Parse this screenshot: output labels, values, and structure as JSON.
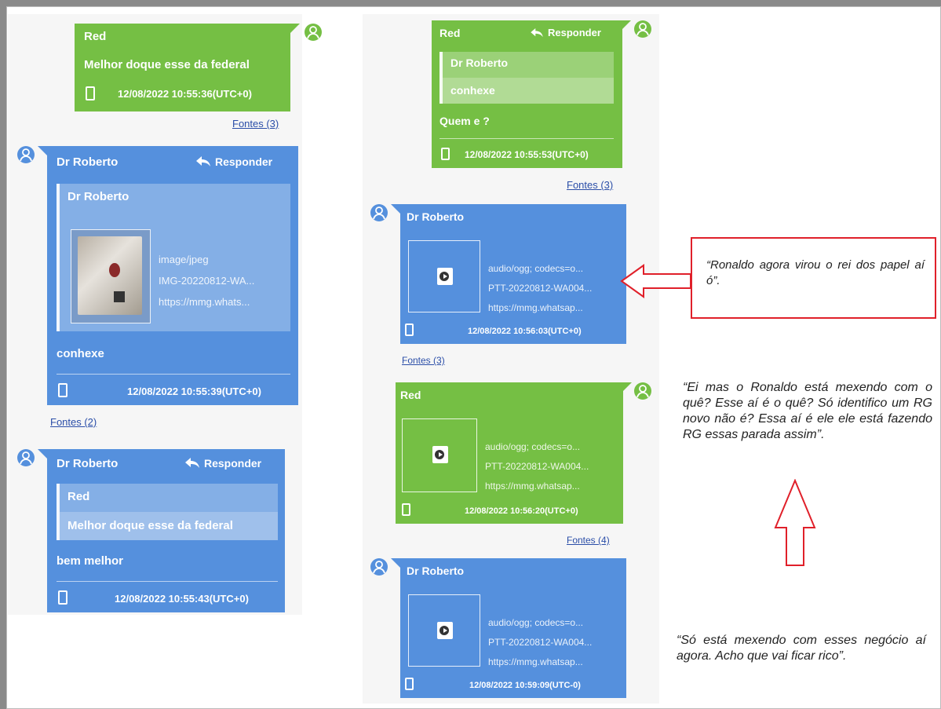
{
  "left_column": {
    "msg1": {
      "sender": "Red",
      "text": "Melhor doque esse da federal",
      "timestamp": "12/08/2022 10:55:36(UTC+0)",
      "fontes": "Fontes (3)"
    },
    "msg2": {
      "sender": "Dr Roberto",
      "reply_label": "Responder",
      "quote_sender": "Dr Roberto",
      "media": {
        "mime": "image/jpeg",
        "filename": "IMG-20220812-WA...",
        "url": "https://mmg.whats..."
      },
      "text": "conhexe",
      "timestamp": "12/08/2022 10:55:39(UTC+0)",
      "fontes": "Fontes (2)"
    },
    "msg3": {
      "sender": "Dr Roberto",
      "reply_label": "Responder",
      "quote_sender": "Red",
      "quote_text": "Melhor doque esse da federal",
      "text": "bem melhor",
      "timestamp": "12/08/2022 10:55:43(UTC+0)"
    }
  },
  "right_column": {
    "msg4": {
      "sender": "Red",
      "reply_label": "Responder",
      "quote_sender": "Dr Roberto",
      "quote_text": "conhexe",
      "text": "Quem e ?",
      "timestamp": "12/08/2022 10:55:53(UTC+0)",
      "fontes": "Fontes (3)"
    },
    "msg5": {
      "sender": "Dr Roberto",
      "media": {
        "mime": "audio/ogg; codecs=o...",
        "filename": "PTT-20220812-WA004...",
        "url": "https://mmg.whatsap..."
      },
      "timestamp": "12/08/2022 10:56:03(UTC+0)",
      "fontes": "Fontes (3)"
    },
    "msg6": {
      "sender": "Red",
      "media": {
        "mime": "audio/ogg; codecs=o...",
        "filename": "PTT-20220812-WA004...",
        "url": "https://mmg.whatsap..."
      },
      "timestamp": "12/08/2022 10:56:20(UTC+0)",
      "fontes": "Fontes (4)"
    },
    "msg7": {
      "sender": "Dr Roberto",
      "media": {
        "mime": "audio/ogg; codecs=o...",
        "filename": "PTT-20220812-WA004...",
        "url": "https://mmg.whatsap..."
      },
      "timestamp": "12/08/2022 10:59:09(UTC-0)"
    }
  },
  "annotations": {
    "a1": "“Ronaldo agora virou o rei dos papel aí ó”.",
    "a2": "“Ei mas o Ronaldo está mexendo com o quê? Esse aí é o quê? Só identifico um RG novo não é? Essa aí é ele ele está fazendo RG essas parada assim”.",
    "a3": "“Só está mexendo com esses negócio aí agora. Acho que vai ficar rico”."
  },
  "colors": {
    "green": "#75bf44",
    "blue": "#5590dd",
    "annotation_red": "#e0202a"
  },
  "icons": [
    "user-avatar-icon",
    "reply-arrow-icon",
    "phone-icon",
    "play-audio-icon",
    "arrow-left-icon",
    "arrow-up-icon"
  ]
}
